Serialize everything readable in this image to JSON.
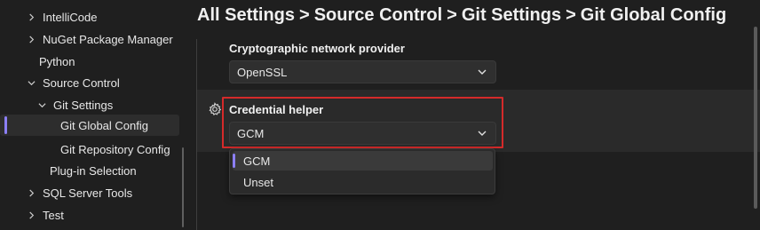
{
  "sidebar": {
    "items": [
      {
        "label": "IntelliCode",
        "chevron": "right"
      },
      {
        "label": "NuGet Package Manager",
        "chevron": "right"
      },
      {
        "label": "Python",
        "chevron": "none"
      },
      {
        "label": "Source Control",
        "chevron": "down"
      },
      {
        "label": "Git Settings",
        "chevron": "down"
      },
      {
        "label": "Git Global Config",
        "chevron": "none",
        "selected": true
      },
      {
        "label": "Git Repository Config",
        "chevron": "none"
      },
      {
        "label": "Plug-in Selection",
        "chevron": "none"
      },
      {
        "label": "SQL Server Tools",
        "chevron": "right"
      },
      {
        "label": "Test",
        "chevron": "right"
      }
    ]
  },
  "header": {
    "crumbs": [
      "All Settings",
      "Source Control",
      "Git Settings",
      "Git Global Config"
    ],
    "separator": ">"
  },
  "settings": {
    "crypto": {
      "label": "Cryptographic network provider",
      "value": "OpenSSL"
    },
    "credential": {
      "label": "Credential helper",
      "value": "GCM"
    }
  },
  "popup": {
    "options": [
      "GCM",
      "Unset"
    ],
    "selected": "GCM"
  },
  "icons": {
    "chevron_right": "chevron-right-icon",
    "chevron_down": "chevron-down-icon",
    "gear": "gear-icon"
  },
  "colors": {
    "accent": "#8c7ff5",
    "focus_outline": "#d52a2a",
    "background": "#1f1f1f"
  }
}
